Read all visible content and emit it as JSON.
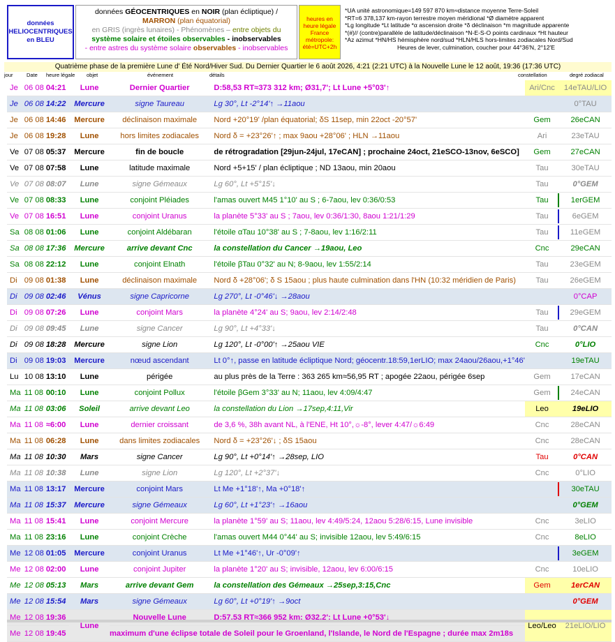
{
  "legend": {
    "helio": "données HELIOCENTRIQUES en BLEU",
    "geo_line1_a": "données ",
    "geo_line1_b": "GÉOCENTRIQUES",
    "geo_line1_c": " en ",
    "geo_line1_d": "NOIR",
    "geo_line1_e": " (plan écliptique)  /",
    "geo_line2_a": "MARRON",
    "geo_line2_b": " (plan équatorial)",
    "geo_line3_a": "en GRIS (ingrès lunaires)  -  Phénomènes – ",
    "geo_line3_b": "entre objets du",
    "geo_line4_a": "système solaire et étoiles observables",
    "geo_line4_b": " - inobservables",
    "geo_line5_a": "- entre astres du système solaire ",
    "geo_line5_b": "observables",
    "geo_line5_c": " - inobservables",
    "time_box": "heures en heure légale France métropole: été=UTC+2h",
    "abbr": [
      "*UA unité astronomique=149 597 870 km≈distance moyenne Terre-Soleil",
      "*RT=6 378,137 km-rayon terrestre moyen méridional   *Ø diamètre apparent",
      "*Lg longitude *Lt latitude   *α ascension droite *δ déclinaison  *m magnitude apparente",
      "*(#)// (contre)parallèle de latitude/déclinaison   *N-E-S-O points cardinaux  *Ht hauteur",
      "*Az azimut   *HN/HS hémisphère nord/sud  *HLN/HLS hors-limites zodiacales Nord/Sud",
      "Heures de lever, culmination, coucher pour 44°36'N, 2°12'E"
    ]
  },
  "title": "Quatrième phase de la première Lune d' Été Nord/Hiver Sud. Du Dernier Quartier le 6 août 2026, 4:21 (2:21 UTC) à la Nouvelle Lune le 12 août, 19:36 (17:36 UTC)",
  "headers": {
    "day": "jour",
    "date": "Date",
    "time": "heure légale",
    "obj": "objet",
    "ev": "événement",
    "det": "détails",
    "con": "constellation",
    "deg": "degré zodiacal"
  },
  "rows": [
    {
      "day": "Je",
      "date": "06 08",
      "time": "04:21",
      "obj": "Lune",
      "ev": "Dernier Quartier",
      "det": "D:58,53 RT≈373 312 km; Ø31,7'; Lt Lune +5°03'↑",
      "con": "Ari/Cnc",
      "deg": "14eTAU/LIO"
    },
    {
      "day": "Je",
      "date": "06 08",
      "time": "14:22",
      "obj": "Mercure",
      "ev": "signe Taureau",
      "det": "Lg 30°, Lt -2°14'↑ →11aou",
      "con": "",
      "deg": "0°TAU"
    },
    {
      "day": "Je",
      "date": "06 08",
      "time": "14:46",
      "obj": "Mercure",
      "ev": "déclinaison maximale",
      "det": "Nord +20°19' /plan équatorial; δS 11sep, min 22oct -20°57'",
      "con": "Gem",
      "deg": "26eCAN"
    },
    {
      "day": "Je",
      "date": "06 08",
      "time": "19:28",
      "obj": "Lune",
      "ev": "hors limites zodiacales",
      "det": "Nord δ = +23°26'↑ ; max 9aou +28°06' ; HLN →11aou",
      "con": "Ari",
      "deg": "23eTAU"
    },
    {
      "day": "Ve",
      "date": "07 08",
      "time": "05:37",
      "obj": "Mercure",
      "ev": "fin de boucle",
      "det": "de rétrogradation [29jun-24jul, 17eCAN] ; prochaine 24oct, 21eSCO-13nov, 6eSCO]",
      "con": "Gem",
      "deg": "27eCAN"
    },
    {
      "day": "Ve",
      "date": "07 08",
      "time": "07:58",
      "obj": "Lune",
      "ev": "latitude maximale",
      "det": "Nord +5+15' / plan écliptique ; ND 13aou, min 20aou",
      "con": "Tau",
      "deg": "30eTAU"
    },
    {
      "day": "Ve",
      "date": "07 08",
      "time": "08:07",
      "obj": "Lune",
      "ev": "signe Gémeaux",
      "det": "Lg 60°, Lt +5°15'↓",
      "con": "Tau",
      "deg": "0°GEM"
    },
    {
      "day": "Ve",
      "date": "07 08",
      "time": "08:33",
      "obj": "Lune",
      "ev": "conjoint Pléiades",
      "det": "l'amas ouvert M45 1°10' au S ; 6-7aou, lev 0:36/0:53",
      "con": "Tau",
      "deg": "1erGEM"
    },
    {
      "day": "Ve",
      "date": "07 08",
      "time": "16:51",
      "obj": "Lune",
      "ev": "conjoint Uranus",
      "det": "la planète 5°33' au S ; 7aou, lev 0:36/1:30, 8aou 1:21/1:29",
      "con": "Tau",
      "deg": "6eGEM"
    },
    {
      "day": "Sa",
      "date": "08 08",
      "time": "01:06",
      "obj": "Lune",
      "ev": "conjoint Aldébaran",
      "det": "l'étoile αTau 10°38' au S ; 7-8aou, lev 1:16/2:11",
      "con": "Tau",
      "deg": "11eGEM"
    },
    {
      "day": "Sa",
      "date": "08 08",
      "time": "17:36",
      "obj": "Mercure",
      "ev": "arrive devant Cnc",
      "det": "la constellation du Cancer →19aou, Leo",
      "con": "Cnc",
      "deg": "29eCAN"
    },
    {
      "day": "Sa",
      "date": "08 08",
      "time": "22:12",
      "obj": "Lune",
      "ev": "conjoint Elnath",
      "det": "l'étoile βTau 0°32' au N; 8-9aou, lev 1:55/2:14",
      "con": "Tau",
      "deg": "23eGEM"
    },
    {
      "day": "Di",
      "date": "09 08",
      "time": "01:38",
      "obj": "Lune",
      "ev": "déclinaison maximale",
      "det": "Nord δ +28°06'; δ S 15aou ; plus haute culmination dans l'HN (10:32 méridien de Paris)",
      "con": "Tau",
      "deg": "26eGEM"
    },
    {
      "day": "Di",
      "date": "09 08",
      "time": "02:46",
      "obj": "Vénus",
      "ev": "signe Capricorne",
      "det": "Lg 270°, Lt -0°46'↓ →28aou",
      "con": "",
      "deg": "0°CAP"
    },
    {
      "day": "Di",
      "date": "09 08",
      "time": "07:26",
      "obj": "Lune",
      "ev": "conjoint Mars",
      "det": "la planète 4°24' au S; 9aou, lev 2:14/2:48",
      "con": "Tau",
      "deg": "29eGEM"
    },
    {
      "day": "Di",
      "date": "09 08",
      "time": "09:45",
      "obj": "Lune",
      "ev": "signe Cancer",
      "det": "Lg 90°, Lt +4°33'↓",
      "con": "Tau",
      "deg": "0°CAN"
    },
    {
      "day": "Di",
      "date": "09 08",
      "time": "18:28",
      "obj": "Mercure",
      "ev": "signe Lion",
      "det": "Lg 120°, Lt -0°00'↑ →25aou VIE",
      "con": "Cnc",
      "deg": "0°LIO"
    },
    {
      "day": "Di",
      "date": "09 08",
      "time": "19:03",
      "obj": "Mercure",
      "ev": "nœud ascendant",
      "det": "Lt 0°↑, passe en latitude écliptique Nord; géocentr.18:59,1erLIO; max 24aou/26aou,+1°46'",
      "con": "",
      "deg": "19eTAU"
    },
    {
      "day": "Lu",
      "date": "10 08",
      "time": "13:10",
      "obj": "Lune",
      "ev": "périgée",
      "det": "au plus près de la Terre : 363 265 km≈56,95 RT ; apogée 22aou, périgée 6sep",
      "con": "Gem",
      "deg": "17eCAN"
    },
    {
      "day": "Ma",
      "date": "11 08",
      "time": "00:10",
      "obj": "Lune",
      "ev": "conjoint Pollux",
      "det": "l'étoile βGem 3°33' au N; 11aou, lev 4:09/4:47",
      "con": "Gem",
      "deg": "24eCAN"
    },
    {
      "day": "Ma",
      "date": "11 08",
      "time": "03:06",
      "obj": "Soleil",
      "ev": "arrive devant Leo",
      "det": "la constellation du Lion →17sep,4:11,Vir",
      "con": "Leo",
      "deg": "19eLIO"
    },
    {
      "day": "Ma",
      "date": "11 08",
      "time": "≈6:00",
      "obj": "Lune",
      "ev": "dernier croissant",
      "det": "de 3,6 %, 38h avant NL, à l'ENE, Ht 10°,☼-8°, lever 4:47/☼6:49",
      "con": "Cnc",
      "deg": "28eCAN"
    },
    {
      "day": "Ma",
      "date": "11 08",
      "time": "06:28",
      "obj": "Lune",
      "ev": "dans limites zodiacales",
      "det": "Nord δ = +23°26'↓ ; δS 15aou",
      "con": "Cnc",
      "deg": "28eCAN"
    },
    {
      "day": "Ma",
      "date": "11 08",
      "time": "10:30",
      "obj": "Mars",
      "ev": "signe Cancer",
      "det": "Lg 90°, Lt +0°14'↑ →28sep, LIO",
      "con": "Tau",
      "deg": "0°CAN"
    },
    {
      "day": "Ma",
      "date": "11 08",
      "time": "10:38",
      "obj": "Lune",
      "ev": "signe Lion",
      "det": "Lg 120°, Lt +2°37'↓",
      "con": "Cnc",
      "deg": "0°LIO"
    },
    {
      "day": "Ma",
      "date": "11 08",
      "time": "13:17",
      "obj": "Mercure",
      "ev": "conjoint Mars",
      "det": "Lt Me +1°18'↑, Ma +0°18'↑",
      "con": "",
      "deg": "30eTAU"
    },
    {
      "day": "Ma",
      "date": "11 08",
      "time": "15:37",
      "obj": "Mercure",
      "ev": "signe Gémeaux",
      "det": "Lg 60°, Lt +1°23'↑ →16aou",
      "con": "",
      "deg": "0°GEM"
    },
    {
      "day": "Ma",
      "date": "11 08",
      "time": "15:41",
      "obj": "Lune",
      "ev": "conjoint Mercure",
      "det": "la planète 1°59' au S; 11aou, lev 4:49/5:24, 12aou 5:28/6:15, Lune invisible",
      "con": "Cnc",
      "deg": "3eLIO"
    },
    {
      "day": "Ma",
      "date": "11 08",
      "time": "23:16",
      "obj": "Lune",
      "ev": "conjoint Crèche",
      "det": "l'amas ouvert M44 0°44' au S; invisible 12aou, lev 5:49/6:15",
      "con": "Cnc",
      "deg": "8eLIO"
    },
    {
      "day": "Me",
      "date": "12 08",
      "time": "01:05",
      "obj": "Mercure",
      "ev": "conjoint Uranus",
      "det": "Lt Me +1°46'↑, Ur -0°09'↑",
      "con": "",
      "deg": "3eGEM"
    },
    {
      "day": "Me",
      "date": "12 08",
      "time": "02:00",
      "obj": "Lune",
      "ev": "conjoint Jupiter",
      "det": "la planète 1°20' au S; invisible, 12aou, lev 6:00/6:15",
      "con": "Cnc",
      "deg": "10eLIO"
    },
    {
      "day": "Me",
      "date": "12 08",
      "time": "05:13",
      "obj": "Mars",
      "ev": "arrive devant Gem",
      "det": "la constellation des Gémeaux →25sep,3:15,Cnc",
      "con": "Gem",
      "deg": "1erCAN"
    },
    {
      "day": "Me",
      "date": "12 08",
      "time": "15:54",
      "obj": "Mars",
      "ev": "signe Gémeaux",
      "det": "Lg 60°, Lt +0°19'↑ →9oct",
      "con": "",
      "deg": "0°GEM"
    },
    {
      "day": "Me",
      "date": "12 08",
      "time": "19:36",
      "obj": "Lune",
      "ev": "Nouvelle Lune",
      "det": "D:57,53 RT≈366 952 km; Ø32,2'; Lt Lune +0°53'↓",
      "con": "Leo/Leo",
      "deg": "21eLIO/LIO"
    },
    {
      "day": "Me",
      "date": "12 08",
      "time": "19:45",
      "obj": "",
      "ev": "",
      "det": "maximum d'une éclipse totale de Soleil pour le Groenland, l'Islande, le Nord de l'Espagne ; durée max 2m18s",
      "con": "",
      "deg": ""
    }
  ],
  "colors": {
    "red": "#e00000",
    "blue": "#1a1ac8",
    "magenta": "#d000d0",
    "green": "#008000",
    "gray": "#8a8a8a",
    "brown": "#a05000",
    "yellow": "#ffff00"
  }
}
